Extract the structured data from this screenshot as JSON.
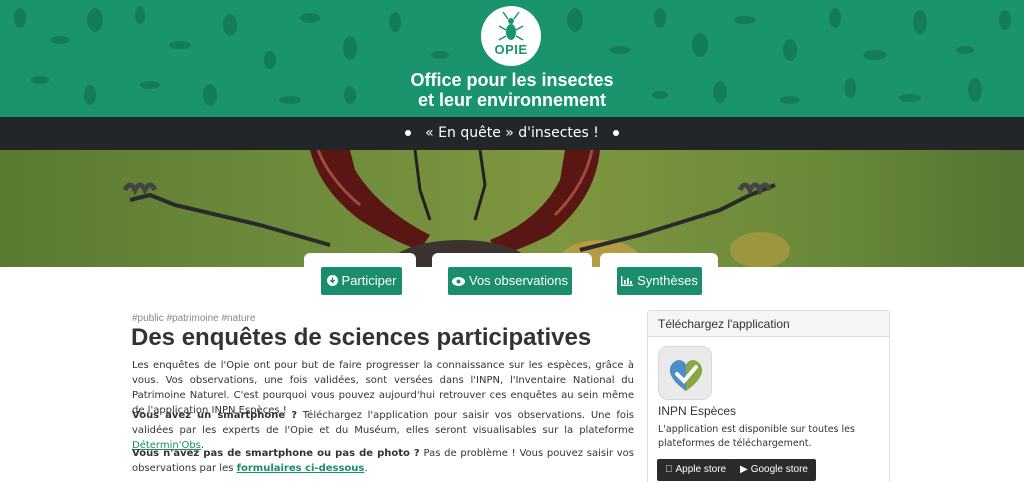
{
  "header": {
    "logo_text": "OPIE",
    "title_line1": "Office pour les insectes",
    "title_line2": "et leur environnement"
  },
  "banner": {
    "text": "« En quête » d'insectes !"
  },
  "tabs": [
    {
      "label": "Participer",
      "icon": "download-circle-icon"
    },
    {
      "label": "Vos observations",
      "icon": "eye-icon"
    },
    {
      "label": "Synthèses",
      "icon": "bar-chart-icon"
    }
  ],
  "main": {
    "tags": "#public #patrimoine #nature",
    "title": "Des enquêtes de sciences participatives",
    "p1": "Les enquêtes de l'Opie ont pour but de faire progresser la connaissance sur les espèces, grâce à vous. Vos observations, une fois validées, sont versées dans l'INPN, l'Inventaire National du Patrimoine Naturel. C'est pourquoi vous pouvez aujourd'hui retrouver ces enquêtes au sein même de l'application INPN Espèces !",
    "p2_bold": "Vous avez un smartphone ?",
    "p2_text": " Téléchargez l'application pour saisir vos observations. Une fois validées par les experts de l'Opie et du Muséum, elles seront visualisables sur la plateforme ",
    "p2_link": "Détermin'Obs",
    "p2_end": ".",
    "p3_bold": "Vous n'avez pas de smartphone ou pas de photo ?",
    "p3_text": " Pas de problème ! Vous pouvez saisir vos observations par les ",
    "p3_link": "formulaires ci-dessous",
    "p3_end": "."
  },
  "sidebar": {
    "card_title": "Téléchargez l'application",
    "app_name": "INPN Espèces",
    "app_desc": "L'application est disponible sur toutes les plateformes de téléchargement.",
    "apple_label": "Apple store",
    "google_label": "Google store"
  },
  "colors": {
    "brand_green": "#19946c",
    "button_green": "#1a8d6a",
    "dark_bar": "#232628"
  }
}
